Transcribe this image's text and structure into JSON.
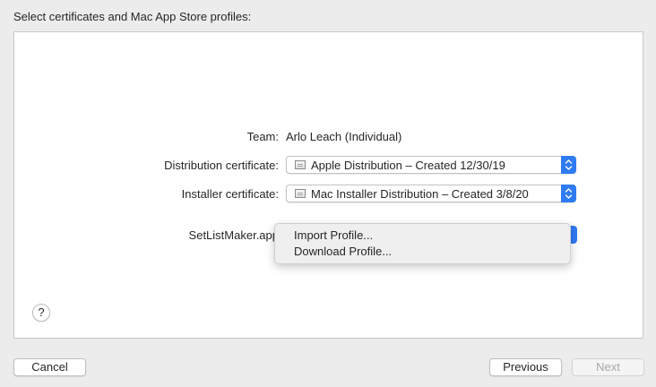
{
  "heading": "Select certificates and Mac App Store profiles:",
  "team": {
    "label": "Team:",
    "value": "Arlo Leach (Individual)"
  },
  "distribution": {
    "label": "Distribution certificate:",
    "value": "Apple Distribution – Created 12/30/19",
    "icon": "certificate-icon"
  },
  "installer": {
    "label": "Installer certificate:",
    "value": "Mac Installer Distribution – Created 3/8/20",
    "icon": "certificate-icon"
  },
  "profile": {
    "label": "SetListMaker.app"
  },
  "profile_menu": {
    "items": [
      {
        "label": "Import Profile..."
      },
      {
        "label": "Download Profile..."
      }
    ]
  },
  "help": {
    "label": "?"
  },
  "buttons": {
    "cancel": "Cancel",
    "previous": "Previous",
    "next": "Next"
  },
  "colors": {
    "accent": "#2f7bf5",
    "window_bg": "#ececec",
    "panel_bg": "#ffffff"
  }
}
